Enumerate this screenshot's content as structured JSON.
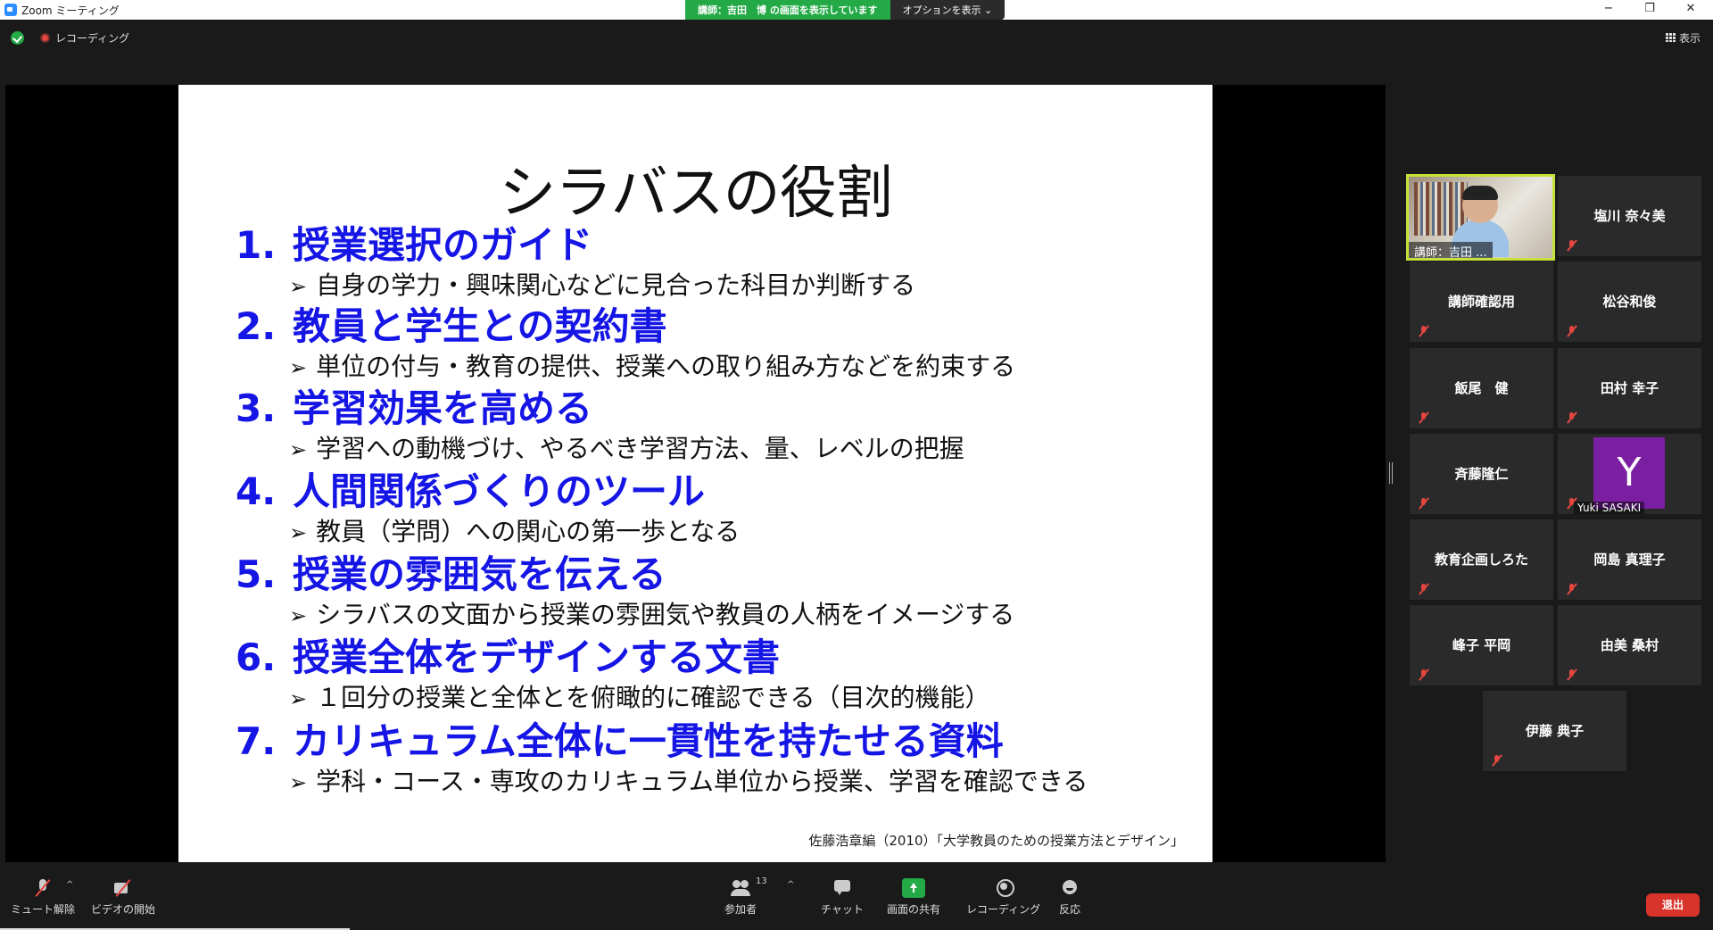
{
  "window": {
    "title": "Zoom ミーティング",
    "share_banner": "講師：吉田　博 の画面を表示しています",
    "options_label": "オプションを表示",
    "minimize": "−",
    "maximize": "❐",
    "close": "✕"
  },
  "topbar": {
    "recording_label": "レコーディング",
    "view_label": "表示"
  },
  "slide": {
    "title": "シラバスの役割",
    "items": [
      {
        "num": "1.",
        "heading": "授業選択のガイド",
        "sub": "自身の学力・興味関心などに見合った科目か判断する"
      },
      {
        "num": "2.",
        "heading": "教員と学生との契約書",
        "sub": "単位の付与・教育の提供、授業への取り組み方などを約束する"
      },
      {
        "num": "3.",
        "heading": "学習効果を高める",
        "sub": "学習への動機づけ、やるべき学習方法、量、レベルの把握"
      },
      {
        "num": "4.",
        "heading": "人間関係づくりのツール",
        "sub": "教員（学問）への関心の第一歩となる"
      },
      {
        "num": "5.",
        "heading": "授業の雰囲気を伝える",
        "sub": "シラバスの文面から授業の雰囲気や教員の人柄をイメージする"
      },
      {
        "num": "6.",
        "heading": "授業全体をデザインする文書",
        "sub": "１回分の授業と全体とを俯瞰的に確認できる（目次的機能）"
      },
      {
        "num": "7.",
        "heading": "カリキュラム全体に一貫性を持たせる資料",
        "sub": "学科・コース・専攻のカリキュラム単位から授業、学習を確認できる"
      }
    ],
    "bullet": "➢",
    "citation": "佐藤浩章編（2010）「大学教員のための授業方法とデザイン」"
  },
  "gallery": {
    "active_speaker": "講師：吉田 ...",
    "participants": [
      "塩川 奈々美",
      "講師確認用",
      "松谷和俊",
      "飯尾　健",
      "田村 幸子",
      "斉藤隆仁",
      "Yuki SASAKI",
      "教育企画しろた",
      "岡島 真理子",
      "峰子 平岡",
      "由美 桑村",
      "伊藤 典子"
    ],
    "avatar_letter": "Y"
  },
  "toolbar": {
    "unmute": "ミュート解除",
    "start_video": "ビデオの開始",
    "participants": "参加者",
    "participants_count": "13",
    "chat": "チャット",
    "share_screen": "画面の共有",
    "recording": "レコーディング",
    "reactions": "反応",
    "leave": "退出"
  },
  "colors": {
    "accent_green": "#23a946",
    "heading_blue": "#1515e6",
    "leave_red": "#d9342b",
    "active_border": "#c6e23a",
    "avatar_purple": "#7b1fa2"
  }
}
